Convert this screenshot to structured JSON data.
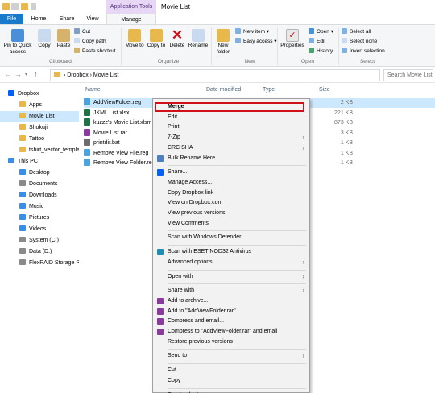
{
  "window": {
    "title": "Movie List",
    "app_tools_label": "Application Tools"
  },
  "ribbon_tabs": [
    "File",
    "Home",
    "Share",
    "View",
    "Manage"
  ],
  "ribbon": {
    "pin_to_quick_access": "Pin to Quick access",
    "copy": "Copy",
    "paste": "Paste",
    "cut": "Cut",
    "copy_path": "Copy path",
    "paste_shortcut": "Paste shortcut",
    "clipboard_label": "Clipboard",
    "move_to": "Move to",
    "copy_to": "Copy to",
    "delete": "Delete",
    "rename": "Rename",
    "organize_label": "Organize",
    "new_folder": "New folder",
    "new_item": "New item",
    "easy_access": "Easy access",
    "new_label": "New",
    "properties": "Properties",
    "open": "Open",
    "edit": "Edit",
    "history": "History",
    "open_label": "Open",
    "select_all": "Select all",
    "select_none": "Select none",
    "invert_selection": "Invert selection",
    "select_label": "Select"
  },
  "address": {
    "crumbs": "›  Dropbox  ›  Movie List",
    "search_placeholder": "Search Movie List"
  },
  "nav_pane": [
    {
      "label": "Dropbox",
      "color": "#0061fe"
    },
    {
      "label": "Apps",
      "color": "#e8b84a"
    },
    {
      "label": "Movie List",
      "color": "#e8b84a",
      "selected": true
    },
    {
      "label": "Shokuji",
      "color": "#e8b84a"
    },
    {
      "label": "Tattoo",
      "color": "#e8b84a"
    },
    {
      "label": "tshirt_vector_templat",
      "color": "#e8b84a"
    },
    {
      "label": "This PC",
      "color": "#3a8ee6"
    },
    {
      "label": "Desktop",
      "color": "#3a8ee6"
    },
    {
      "label": "Documents",
      "color": "#8a8a8a"
    },
    {
      "label": "Downloads",
      "color": "#3a8ee6"
    },
    {
      "label": "Music",
      "color": "#3a8ee6"
    },
    {
      "label": "Pictures",
      "color": "#3a8ee6"
    },
    {
      "label": "Videos",
      "color": "#3a8ee6"
    },
    {
      "label": "System (C:)",
      "color": "#8a8a8a"
    },
    {
      "label": "Data (D:)",
      "color": "#8a8a8a"
    },
    {
      "label": "FlexRAID Storage Poc",
      "color": "#8a8a8a"
    }
  ],
  "columns": {
    "name": "Name",
    "date_modified": "Date modified",
    "type": "Type",
    "size": "Size"
  },
  "files": [
    {
      "name": "AddViewFolder.reg",
      "size": "2 KB",
      "icon_color": "#4aa3df",
      "selected": true
    },
    {
      "name": "JKML List.xlsx",
      "size": "221 KB",
      "icon_color": "#1f7244"
    },
    {
      "name": "kuzzz's Movie List.xlsm",
      "size": "873 KB",
      "icon_color": "#1f7244"
    },
    {
      "name": "Movie List.rar",
      "size": "3 KB",
      "icon_color": "#8b3aa0"
    },
    {
      "name": "printdir.bat",
      "size": "1 KB",
      "icon_color": "#6d6d6d"
    },
    {
      "name": "Remove View File.reg",
      "size": "1 KB",
      "icon_color": "#4aa3df"
    },
    {
      "name": "Remove View Folder.reg",
      "size": "1 KB",
      "icon_color": "#4aa3df"
    }
  ],
  "context_menu": [
    {
      "label": "Merge",
      "bold": true,
      "highlight": true
    },
    {
      "label": "Edit"
    },
    {
      "label": "Print"
    },
    {
      "label": "7-Zip",
      "submenu": true
    },
    {
      "label": "CRC SHA",
      "submenu": true
    },
    {
      "label": "Bulk Rename Here",
      "icon": "#4a7fc1"
    },
    {
      "sep": true
    },
    {
      "label": "Share...",
      "icon": "#0061fe"
    },
    {
      "label": "Manage Access..."
    },
    {
      "label": "Copy Dropbox link"
    },
    {
      "label": "View on Dropbox.com"
    },
    {
      "label": "View previous versions"
    },
    {
      "label": "View Comments"
    },
    {
      "sep": true
    },
    {
      "label": "Scan with Windows Defender..."
    },
    {
      "sep": true
    },
    {
      "label": "Scan with ESET NOD32 Antivirus",
      "icon": "#1a8fb5"
    },
    {
      "label": "Advanced options",
      "submenu": true
    },
    {
      "sep": true
    },
    {
      "label": "Open with",
      "submenu": true
    },
    {
      "sep": true
    },
    {
      "label": "Share with",
      "submenu": true
    },
    {
      "label": "Add to archive...",
      "icon": "#8b3aa0"
    },
    {
      "label": "Add to \"AddViewFolder.rar\"",
      "icon": "#8b3aa0"
    },
    {
      "label": "Compress and email...",
      "icon": "#8b3aa0"
    },
    {
      "label": "Compress to \"AddViewFolder.rar\" and email",
      "icon": "#8b3aa0"
    },
    {
      "label": "Restore previous versions"
    },
    {
      "sep": true
    },
    {
      "label": "Send to",
      "submenu": true
    },
    {
      "sep": true
    },
    {
      "label": "Cut"
    },
    {
      "label": "Copy"
    },
    {
      "sep": true
    },
    {
      "label": "Create shortcut"
    }
  ]
}
